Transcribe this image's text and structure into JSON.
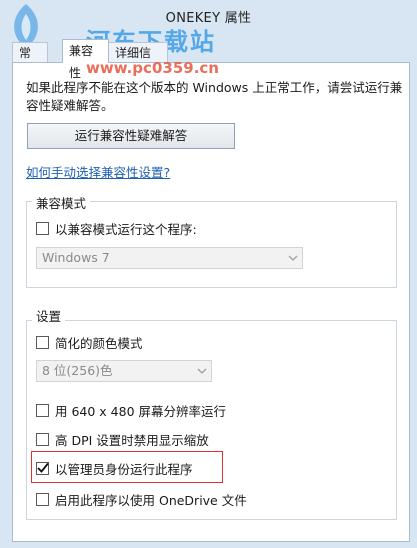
{
  "window": {
    "title": "ONEKEY 属性"
  },
  "watermark": {
    "site": "河东下载站",
    "url": "www.pc0359.cn"
  },
  "tabs": [
    {
      "label": "常规",
      "active": false
    },
    {
      "label": "兼容性",
      "active": true
    },
    {
      "label": "详细信息",
      "active": false
    }
  ],
  "intro": {
    "description": "如果此程序不能在这个版本的 Windows 上正常工作，请尝试运行兼容性疑难解答。",
    "troubleshoot_button": "运行兼容性疑难解答",
    "manual_link": "如何手动选择兼容性设置?"
  },
  "compat_mode": {
    "group_label": "兼容模式",
    "checkbox_label": "以兼容模式运行这个程序:",
    "checked": false,
    "os_select_value": "Windows 7"
  },
  "settings": {
    "group_label": "设置",
    "reduced_color": {
      "label": "简化的颜色模式",
      "checked": false
    },
    "color_select_value": "8 位(256)色",
    "res_640": {
      "label": "用 640 x 480 屏幕分辨率运行",
      "checked": false
    },
    "high_dpi": {
      "label": "高 DPI 设置时禁用显示缩放",
      "checked": false
    },
    "run_as_admin": {
      "label": "以管理员身份运行此程序",
      "checked": true
    },
    "onedrive": {
      "label": "启用此程序以使用 OneDrive 文件",
      "checked": false
    }
  },
  "colors": {
    "accent_link": "#1c5fb1",
    "highlight_box": "#d9342b",
    "chrome": "#d8e6f3"
  }
}
